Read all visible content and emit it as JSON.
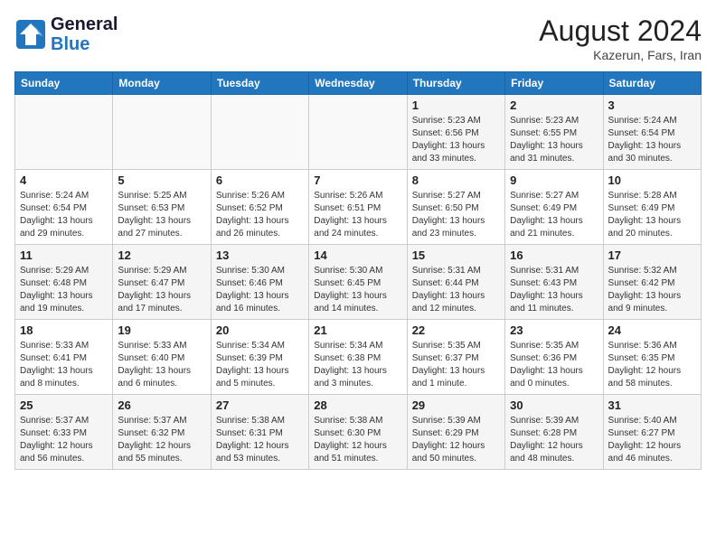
{
  "header": {
    "logo_line1": "General",
    "logo_line2": "Blue",
    "month_year": "August 2024",
    "location": "Kazerun, Fars, Iran"
  },
  "days_of_week": [
    "Sunday",
    "Monday",
    "Tuesday",
    "Wednesday",
    "Thursday",
    "Friday",
    "Saturday"
  ],
  "weeks": [
    [
      {
        "num": "",
        "info": ""
      },
      {
        "num": "",
        "info": ""
      },
      {
        "num": "",
        "info": ""
      },
      {
        "num": "",
        "info": ""
      },
      {
        "num": "1",
        "info": "Sunrise: 5:23 AM\nSunset: 6:56 PM\nDaylight: 13 hours\nand 33 minutes."
      },
      {
        "num": "2",
        "info": "Sunrise: 5:23 AM\nSunset: 6:55 PM\nDaylight: 13 hours\nand 31 minutes."
      },
      {
        "num": "3",
        "info": "Sunrise: 5:24 AM\nSunset: 6:54 PM\nDaylight: 13 hours\nand 30 minutes."
      }
    ],
    [
      {
        "num": "4",
        "info": "Sunrise: 5:24 AM\nSunset: 6:54 PM\nDaylight: 13 hours\nand 29 minutes."
      },
      {
        "num": "5",
        "info": "Sunrise: 5:25 AM\nSunset: 6:53 PM\nDaylight: 13 hours\nand 27 minutes."
      },
      {
        "num": "6",
        "info": "Sunrise: 5:26 AM\nSunset: 6:52 PM\nDaylight: 13 hours\nand 26 minutes."
      },
      {
        "num": "7",
        "info": "Sunrise: 5:26 AM\nSunset: 6:51 PM\nDaylight: 13 hours\nand 24 minutes."
      },
      {
        "num": "8",
        "info": "Sunrise: 5:27 AM\nSunset: 6:50 PM\nDaylight: 13 hours\nand 23 minutes."
      },
      {
        "num": "9",
        "info": "Sunrise: 5:27 AM\nSunset: 6:49 PM\nDaylight: 13 hours\nand 21 minutes."
      },
      {
        "num": "10",
        "info": "Sunrise: 5:28 AM\nSunset: 6:49 PM\nDaylight: 13 hours\nand 20 minutes."
      }
    ],
    [
      {
        "num": "11",
        "info": "Sunrise: 5:29 AM\nSunset: 6:48 PM\nDaylight: 13 hours\nand 19 minutes."
      },
      {
        "num": "12",
        "info": "Sunrise: 5:29 AM\nSunset: 6:47 PM\nDaylight: 13 hours\nand 17 minutes."
      },
      {
        "num": "13",
        "info": "Sunrise: 5:30 AM\nSunset: 6:46 PM\nDaylight: 13 hours\nand 16 minutes."
      },
      {
        "num": "14",
        "info": "Sunrise: 5:30 AM\nSunset: 6:45 PM\nDaylight: 13 hours\nand 14 minutes."
      },
      {
        "num": "15",
        "info": "Sunrise: 5:31 AM\nSunset: 6:44 PM\nDaylight: 13 hours\nand 12 minutes."
      },
      {
        "num": "16",
        "info": "Sunrise: 5:31 AM\nSunset: 6:43 PM\nDaylight: 13 hours\nand 11 minutes."
      },
      {
        "num": "17",
        "info": "Sunrise: 5:32 AM\nSunset: 6:42 PM\nDaylight: 13 hours\nand 9 minutes."
      }
    ],
    [
      {
        "num": "18",
        "info": "Sunrise: 5:33 AM\nSunset: 6:41 PM\nDaylight: 13 hours\nand 8 minutes."
      },
      {
        "num": "19",
        "info": "Sunrise: 5:33 AM\nSunset: 6:40 PM\nDaylight: 13 hours\nand 6 minutes."
      },
      {
        "num": "20",
        "info": "Sunrise: 5:34 AM\nSunset: 6:39 PM\nDaylight: 13 hours\nand 5 minutes."
      },
      {
        "num": "21",
        "info": "Sunrise: 5:34 AM\nSunset: 6:38 PM\nDaylight: 13 hours\nand 3 minutes."
      },
      {
        "num": "22",
        "info": "Sunrise: 5:35 AM\nSunset: 6:37 PM\nDaylight: 13 hours\nand 1 minute."
      },
      {
        "num": "23",
        "info": "Sunrise: 5:35 AM\nSunset: 6:36 PM\nDaylight: 13 hours\nand 0 minutes."
      },
      {
        "num": "24",
        "info": "Sunrise: 5:36 AM\nSunset: 6:35 PM\nDaylight: 12 hours\nand 58 minutes."
      }
    ],
    [
      {
        "num": "25",
        "info": "Sunrise: 5:37 AM\nSunset: 6:33 PM\nDaylight: 12 hours\nand 56 minutes."
      },
      {
        "num": "26",
        "info": "Sunrise: 5:37 AM\nSunset: 6:32 PM\nDaylight: 12 hours\nand 55 minutes."
      },
      {
        "num": "27",
        "info": "Sunrise: 5:38 AM\nSunset: 6:31 PM\nDaylight: 12 hours\nand 53 minutes."
      },
      {
        "num": "28",
        "info": "Sunrise: 5:38 AM\nSunset: 6:30 PM\nDaylight: 12 hours\nand 51 minutes."
      },
      {
        "num": "29",
        "info": "Sunrise: 5:39 AM\nSunset: 6:29 PM\nDaylight: 12 hours\nand 50 minutes."
      },
      {
        "num": "30",
        "info": "Sunrise: 5:39 AM\nSunset: 6:28 PM\nDaylight: 12 hours\nand 48 minutes."
      },
      {
        "num": "31",
        "info": "Sunrise: 5:40 AM\nSunset: 6:27 PM\nDaylight: 12 hours\nand 46 minutes."
      }
    ]
  ]
}
